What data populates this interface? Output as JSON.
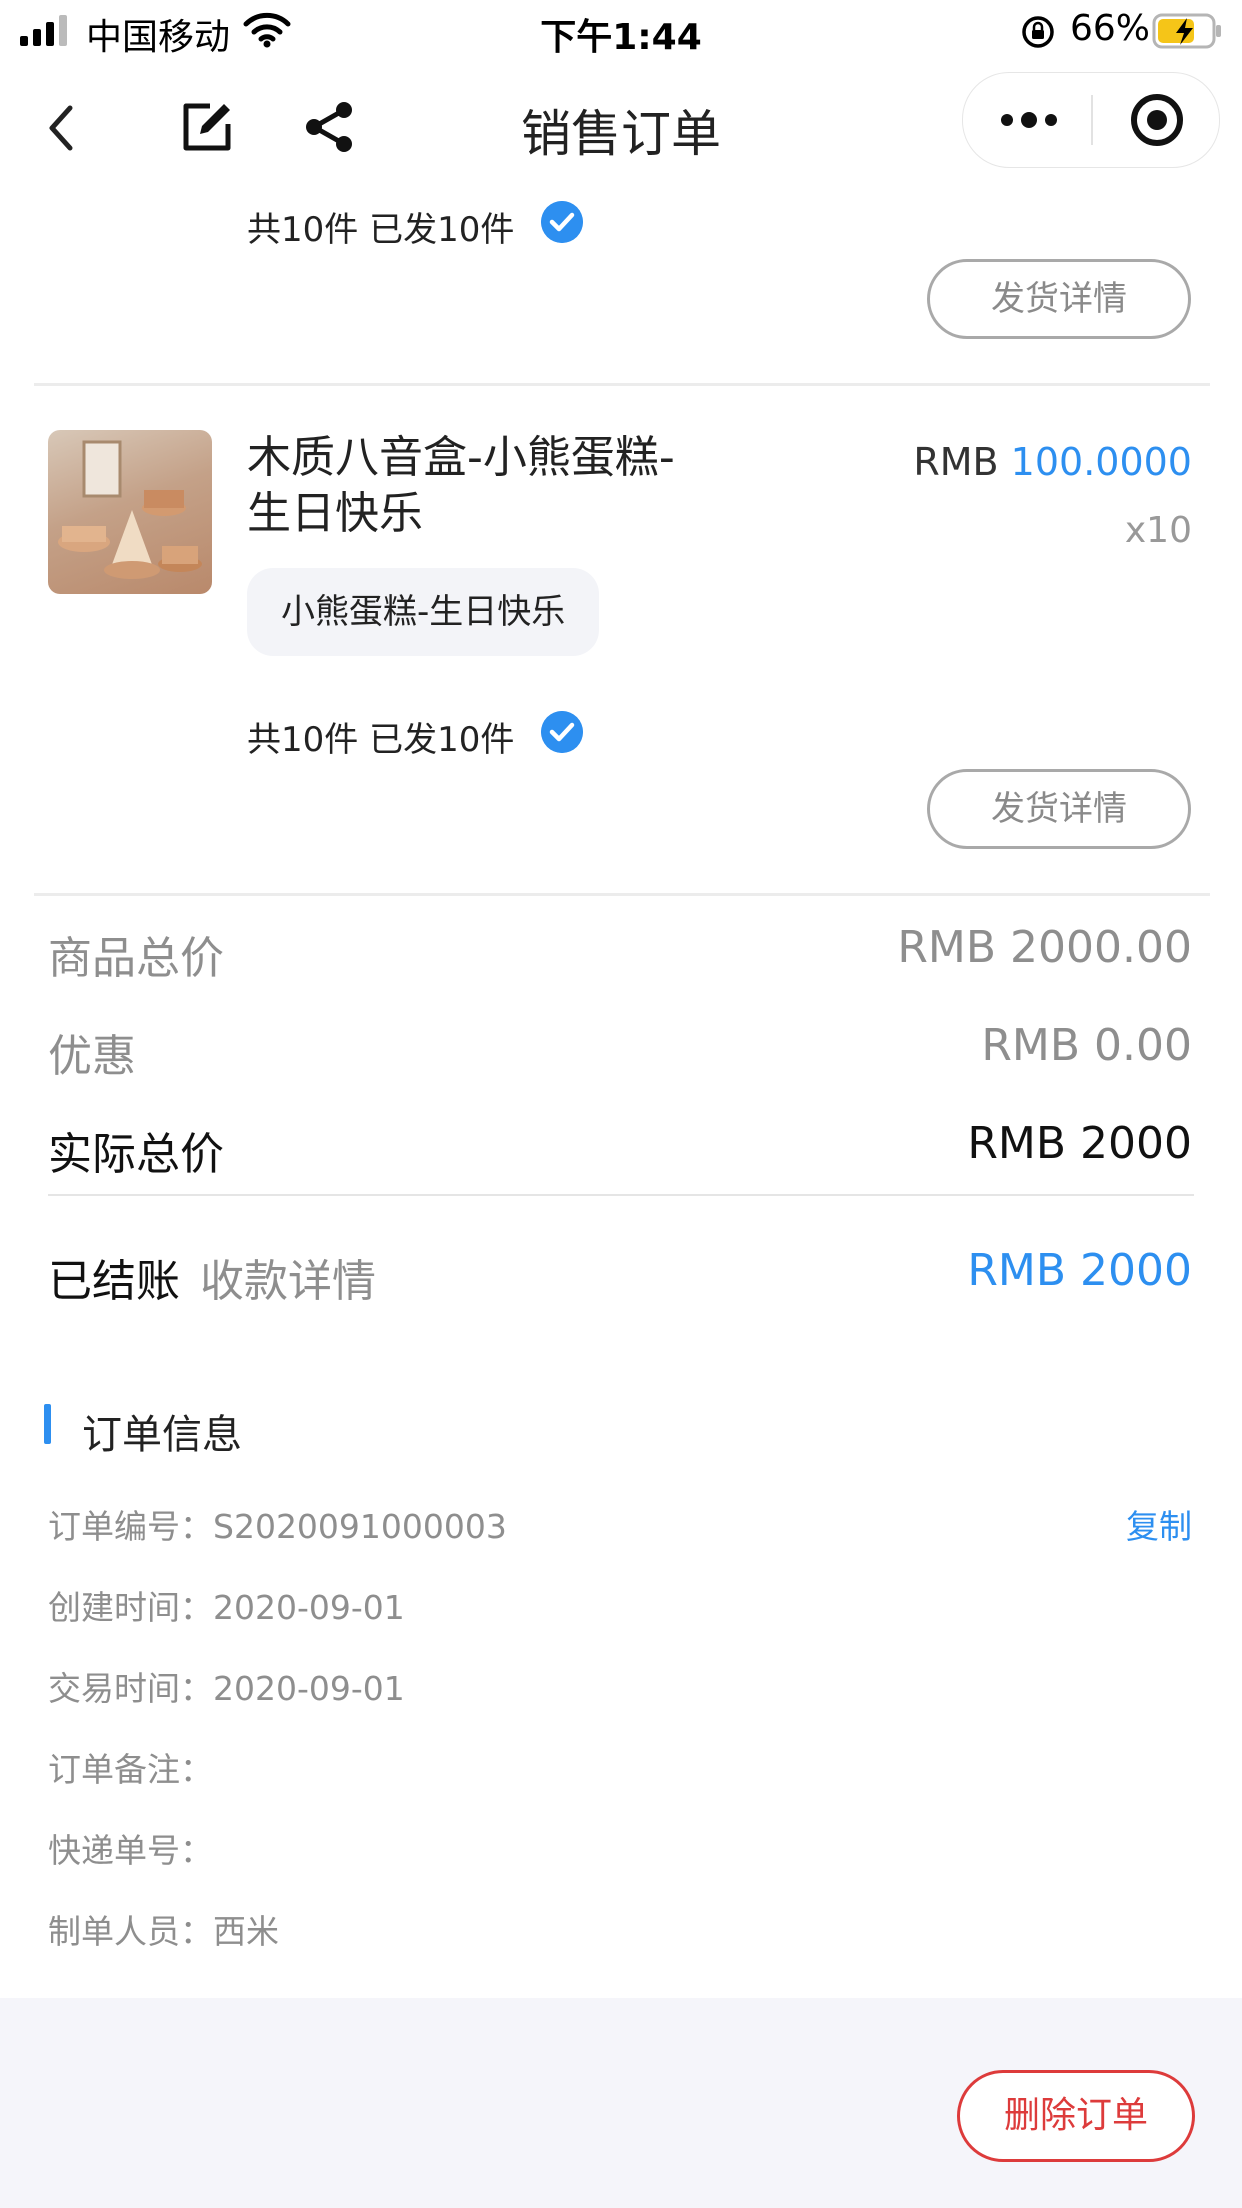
{
  "status_bar": {
    "carrier": "中国移动",
    "time": "下午1:44",
    "battery": "66%"
  },
  "nav": {
    "title": "销售订单"
  },
  "shipment_prev": {
    "summary": "共10件  已发10件",
    "button": "发货详情"
  },
  "item": {
    "name_line1": "木质八音盒-小熊蛋糕-",
    "name_line2": "生日快乐",
    "currency": "RMB",
    "price": "100.0000",
    "qty": "x10",
    "spec": "小熊蛋糕-生日快乐",
    "summary": "共10件  已发10件",
    "button": "发货详情"
  },
  "totals": {
    "goods_label": "商品总价",
    "goods_value": "RMB 2000.00",
    "discount_label": "优惠",
    "discount_value": "RMB 0.00",
    "actual_label": "实际总价",
    "actual_value": "RMB 2000",
    "settled_label": "已结账",
    "payment_detail_link": "收款详情",
    "settled_value": "RMB 2000"
  },
  "order_info": {
    "title": "订单信息",
    "copy": "复制",
    "rows": [
      "订单编号：S2020091000003",
      "创建时间：2020-09-01",
      "交易时间：2020-09-01",
      "订单备注：",
      "快递单号：",
      "制单人员：西米"
    ]
  },
  "footer": {
    "delete_button": "删除订单"
  },
  "colors": {
    "accent": "#2d8ff0",
    "danger": "#dd3b3b",
    "muted": "#8e8e8e"
  },
  "icons": [
    "signal-icon",
    "wifi-icon",
    "lock-rotation-icon",
    "battery-icon",
    "back-icon",
    "edit-icon",
    "share-icon",
    "more-icon",
    "target-icon",
    "check-icon"
  ]
}
